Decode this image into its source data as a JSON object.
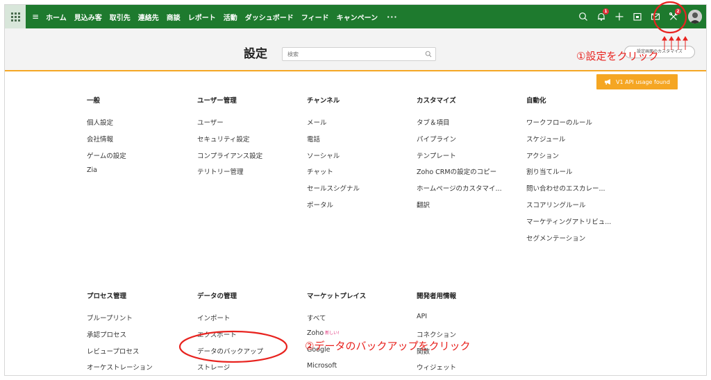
{
  "nav": {
    "items": [
      "ホーム",
      "見込み客",
      "取引先",
      "連絡先",
      "商談",
      "レポート",
      "活動",
      "ダッシュボード",
      "フィード",
      "キャンペーン"
    ],
    "more": "···",
    "notification_count": "1",
    "settings_badge": "2"
  },
  "header": {
    "title": "設定",
    "search_placeholder": "検索",
    "customize_label": "設定画面のカスタマイズ"
  },
  "api_badge": "V1 API usage found",
  "sections_top": [
    {
      "title": "一般",
      "items": [
        "個人設定",
        "会社情報",
        "ゲームの設定",
        "Zia"
      ]
    },
    {
      "title": "ユーザー管理",
      "items": [
        "ユーザー",
        "セキュリティ設定",
        "コンプライアンス設定",
        "テリトリー管理"
      ]
    },
    {
      "title": "チャンネル",
      "items": [
        "メール",
        "電話",
        "ソーシャル",
        "チャット",
        "セールスシグナル",
        "ポータル"
      ]
    },
    {
      "title": "カスタマイズ",
      "items": [
        "タブ＆項目",
        "パイプライン",
        "テンプレート",
        "Zoho CRMの設定のコピー",
        "ホームページのカスタマイ...",
        "翻訳"
      ]
    },
    {
      "title": "自動化",
      "items": [
        "ワークフローのルール",
        "スケジュール",
        "アクション",
        "割り当てルール",
        "問い合わせのエスカレー...",
        "スコアリングルール",
        "マーケティングアトリビュ...",
        "セグメンテーション"
      ]
    }
  ],
  "sections_bottom": [
    {
      "title": "プロセス管理",
      "items": [
        "ブループリント",
        "承認プロセス",
        "レビュープロセス",
        "オーケストレーション"
      ]
    },
    {
      "title": "データの管理",
      "items": [
        "インポート",
        "エクスポート",
        "データのバックアップ",
        "ストレージ"
      ]
    },
    {
      "title": "マーケットプレイス",
      "items": [
        "すべて",
        "Zoho",
        "Google",
        "Microsoft"
      ],
      "new_tag": "新しい!"
    },
    {
      "title": "開発者用情報",
      "items": [
        "API",
        "コネクション",
        "関数",
        "ウィジェット"
      ]
    }
  ],
  "annotations": {
    "step1": "①設定をクリック",
    "step2": "②データのバックアップをクリック"
  },
  "colors": {
    "nav_bg": "#1e7a2e",
    "accent": "#f5a623",
    "annotation": "#e8231f"
  }
}
